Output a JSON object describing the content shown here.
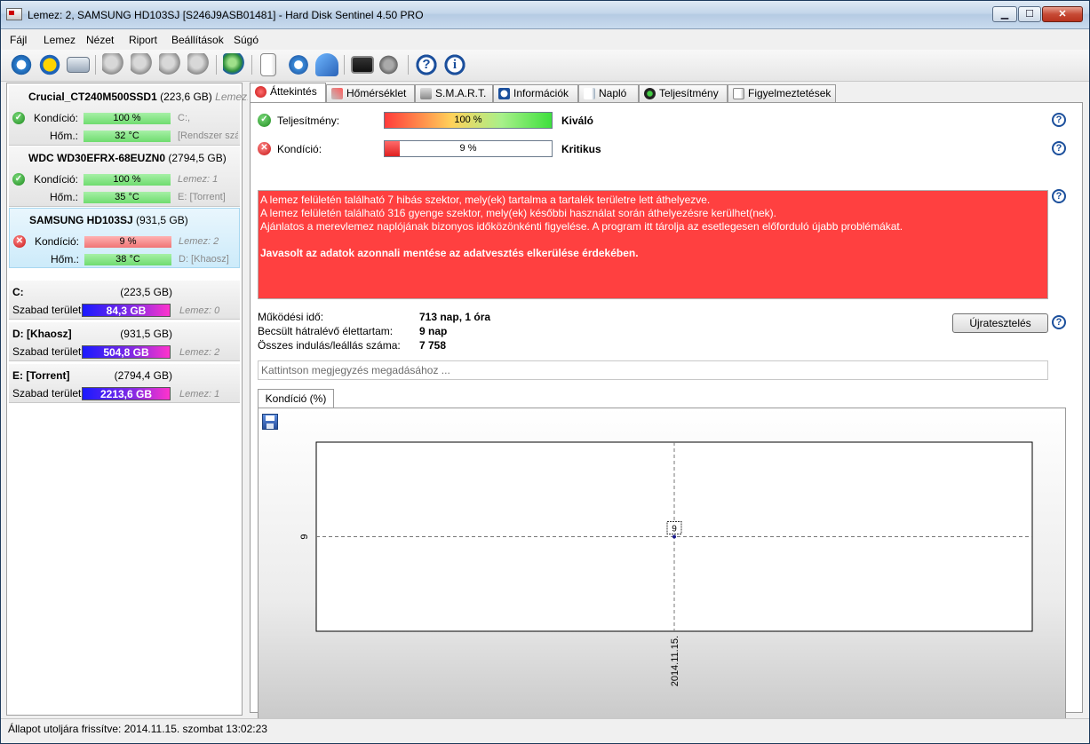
{
  "window": {
    "title": "Lemez: 2, SAMSUNG HD103SJ [S246J9ASB01481]  -  Hard Disk Sentinel 4.50 PRO",
    "minimize": "▁",
    "maximize": "☐",
    "close": "✕"
  },
  "menu": [
    "Fájl",
    "Lemez",
    "Nézet",
    "Riport",
    "Beállítások",
    "Súgó"
  ],
  "disks": [
    {
      "name": "Crucial_CT240M500SSD1",
      "capacity": "(223,6 GB)",
      "name_suffix": "Lemez:",
      "health_label": "Kondíció:",
      "health": "100 %",
      "health_value": 100,
      "temp_label": "Hőm.:",
      "temp": "32 °C",
      "extra1": "C:,",
      "extra2": "[Rendszer szá",
      "status": "ok"
    },
    {
      "name": "WDC WD30EFRX-68EUZN0",
      "capacity": "(2794,5 GB)",
      "name_suffix": "",
      "health_label": "Kondíció:",
      "health": "100 %",
      "health_value": 100,
      "temp_label": "Hőm.:",
      "temp": "35 °C",
      "extra1": "Lemez: 1",
      "extra2": "E: [Torrent]",
      "status": "ok"
    },
    {
      "name": "SAMSUNG HD103SJ",
      "capacity": "(931,5 GB)",
      "name_suffix": "",
      "health_label": "Kondíció:",
      "health": "9 %",
      "health_value": 9,
      "temp_label": "Hőm.:",
      "temp": "38 °C",
      "extra1": "Lemez: 2",
      "extra2": "D: [Khaosz]",
      "status": "error"
    }
  ],
  "partitions": [
    {
      "name": "C:",
      "capacity": "(223,5 GB)",
      "free_label": "Szabad terület",
      "free": "84,3 GB",
      "disk": "Lemez: 0"
    },
    {
      "name": "D: [Khaosz]",
      "capacity": "(931,5 GB)",
      "free_label": "Szabad terület",
      "free": "504,8 GB",
      "disk": "Lemez: 2"
    },
    {
      "name": "E: [Torrent]",
      "capacity": "(2794,4 GB)",
      "free_label": "Szabad terület",
      "free": "2213,6 GB",
      "disk": "Lemez: 1"
    }
  ],
  "tabs": [
    "Áttekintés",
    "Hőmérséklet",
    "S.M.A.R.T.",
    "Információk",
    "Napló",
    "Teljesítmény",
    "Figyelmeztetések"
  ],
  "overview": {
    "performance_label": "Teljesítmény:",
    "performance": "100 %",
    "performance_value": 100,
    "performance_verdict": "Kiváló",
    "health_label": "Kondíció:",
    "health": "9 %",
    "health_value": 9,
    "health_verdict": "Kritikus",
    "help": "?",
    "alert_lines": [
      "A lemez felületén található 7 hibás szektor, mely(ek) tartalma a tartalék területre lett áthelyezve.",
      "A lemez felületén található 316 gyenge szektor, mely(ek) későbbi használat során áthelyezésre kerülhet(nek).",
      "Ajánlatos a merevlemez naplójának bizonyos időközönkénti figyelése. A program itt tárolja az esetlegesen előforduló újabb problémákat."
    ],
    "alert_strong": "Javasolt az adatok azonnali mentése az adatvesztés elkerülése érdekében.",
    "uptime_label": "Működési idő:",
    "uptime": "713 nap, 1 óra",
    "remaining_label": "Becsült hátralévő élettartam:",
    "remaining": "9 nap",
    "startstop_label": "Összes indulás/leállás száma:",
    "startstop": "7 758",
    "retest_button": "Újratesztelés",
    "note_placeholder": "Kattintson megjegyzés megadásához ..."
  },
  "chart_tab": "Kondíció  (%)",
  "chart_data": {
    "type": "line",
    "x": [
      "2014.11.15."
    ],
    "series": [
      {
        "values": [
          9
        ]
      }
    ],
    "y_ticks": [
      "9"
    ],
    "x_ticks": [
      "2014.11.15."
    ],
    "point_labels": [
      "9"
    ],
    "grid": true
  },
  "status": {
    "text": "Állapot utoljára frissítve: 2014.11.15. szombat 13:02:23"
  },
  "colors": {
    "alert_bg": "#ff4040",
    "healthy": "#6fdc6f",
    "critical": "#f07575",
    "free_space_gradient_start": "#1a1aff",
    "free_space_gradient_end": "#ff33cc"
  }
}
